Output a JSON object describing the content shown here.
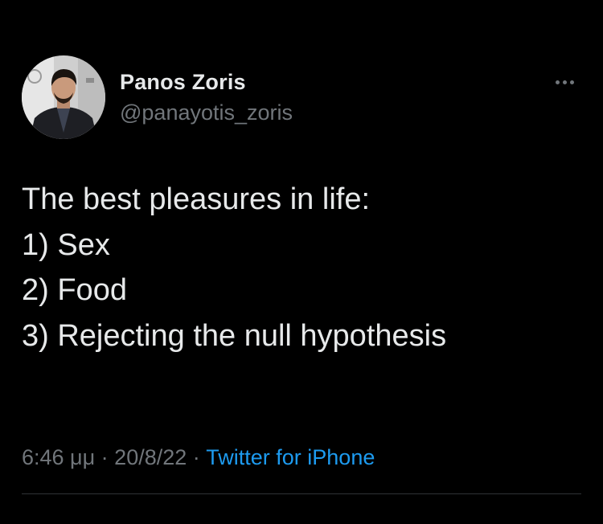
{
  "author": {
    "display_name": "Panos Zoris",
    "handle": "@panayotis_zoris",
    "avatar": "profile-photo"
  },
  "more_icon": "more-horizontal-icon",
  "tweet": {
    "lines": [
      "The best pleasures in life:",
      "1) Sex",
      "2) Food",
      "3) Rejecting the null hypothesis"
    ]
  },
  "meta": {
    "time": "6:46 μμ",
    "separator": " · ",
    "date": "20/8/22",
    "source": "Twitter for iPhone"
  },
  "colors": {
    "background": "#000000",
    "primary_text": "#e7e9ea",
    "secondary_text": "#71767b",
    "link": "#1d9bf0",
    "divider": "#2f3336"
  }
}
